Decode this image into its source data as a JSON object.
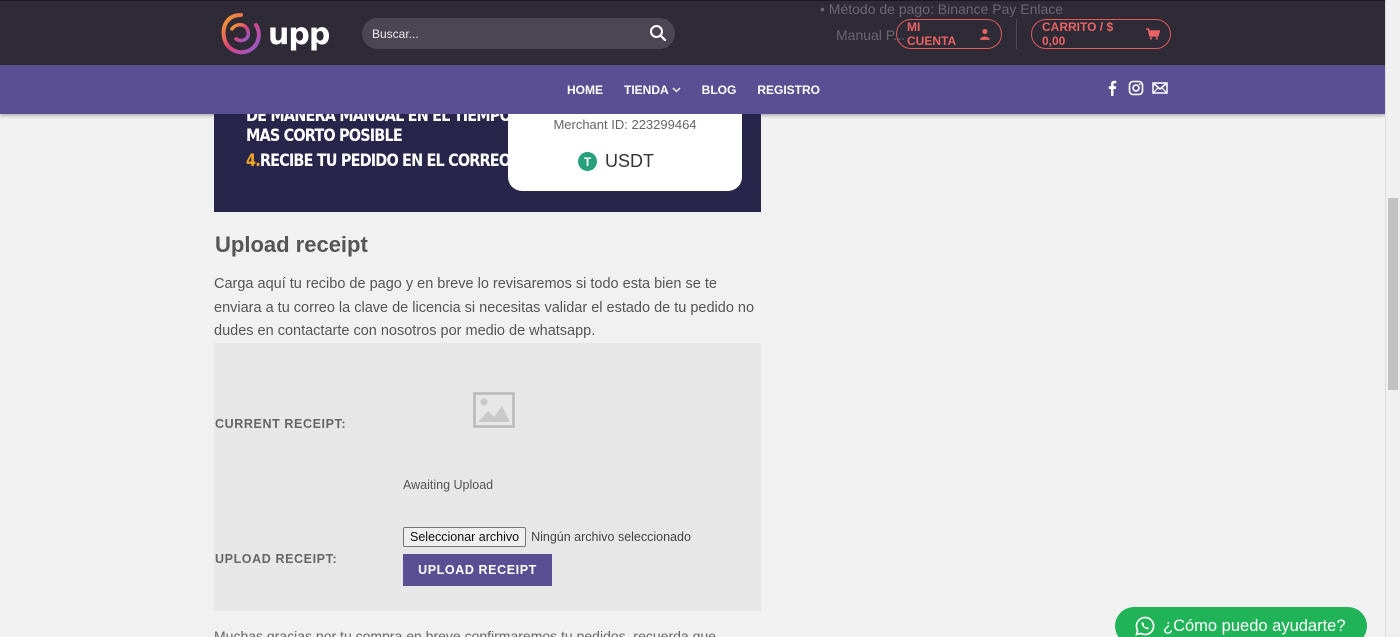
{
  "header": {
    "logo_text": "upp",
    "search": {
      "placeholder": "Buscar..."
    },
    "bg_bullets": [
      "• Método de pago: Binance Pay Enlace",
      "Manual P..."
    ],
    "account_label": "MI CUENTA",
    "cart_label": "CARRITO / $ 0,00"
  },
  "nav": {
    "items": [
      {
        "label": "HOME"
      },
      {
        "label": "TIENDA"
      },
      {
        "label": "BLOG"
      },
      {
        "label": "REGISTRO"
      }
    ],
    "social": [
      "facebook-icon",
      "instagram-icon",
      "email-icon"
    ]
  },
  "banner": {
    "line1": "DE MANERA MANUAL EN EL TIEMPO",
    "line2": "MAS CORTO POSIBLE",
    "line3_num": "4.",
    "line3_text": "RECIBE TU PEDIDO EN EL CORREO",
    "merchant": "Merchant ID: 223299464",
    "currency_symbol": "T",
    "currency": "USDT"
  },
  "main": {
    "title": "Upload receipt",
    "description": "Carga aquí tu recibo de pago y en breve lo revisaremos si todo esta bien se te enviara a tu correo la clave de licencia si necesitas validar el estado de tu pedido no dudes en contactarte con nosotros por medio de whatsapp.",
    "current_receipt_label": "CURRENT RECEIPT:",
    "awaiting": "Awaiting Upload",
    "upload_receipt_label": "UPLOAD RECEIPT:",
    "file_button": "Seleccionar archivo",
    "file_status": "Ningún archivo seleccionado",
    "upload_button": "UPLOAD RECEIPT",
    "footer_partial": "Muchas gracias por tu compra en breve confirmaremos tu pedidos, recuerda que"
  },
  "whatsapp": {
    "label": "¿Cómo puedo ayudarte?"
  },
  "colors": {
    "header": "#2e2a36",
    "nav": "#5b4f94",
    "accent": "#e05a5a",
    "whatsapp": "#20b358"
  }
}
